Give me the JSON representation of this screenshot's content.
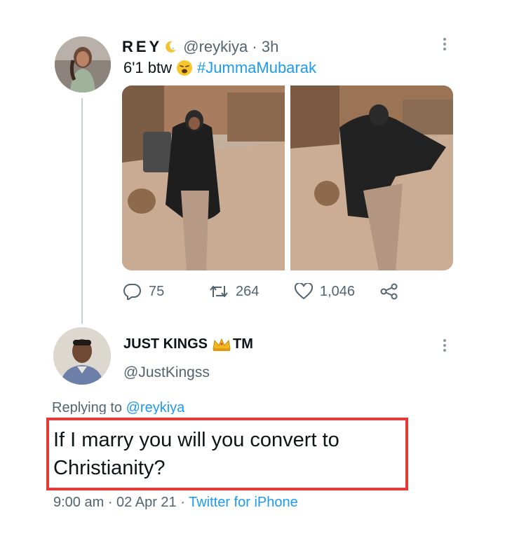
{
  "tweet": {
    "author_name": "REY",
    "handle": "@reykiya",
    "time_ago": "3h",
    "text": "6'1 btw",
    "hashtag": "#JummaMubarak",
    "emoji_icon": "weary-face-icon",
    "name_icon": "crescent-moon-icon",
    "stats": {
      "replies": "75",
      "retweets": "264",
      "likes": "1,046"
    }
  },
  "reply": {
    "author_name": "JUST KINGS",
    "name_badge_icon": "crown-icon",
    "name_suffix": "TM",
    "handle": "@JustKingss",
    "replying_prefix": "Replying to",
    "replying_handle": "@reykiya",
    "text": "If I marry you will you convert to Christianity?",
    "time": "9:00 am",
    "date": "02 Apr 21",
    "source": "Twitter for iPhone"
  },
  "colors": {
    "link": "#1d9bf0",
    "secondary_text": "#536471",
    "highlight_box": "#e53a3a"
  }
}
